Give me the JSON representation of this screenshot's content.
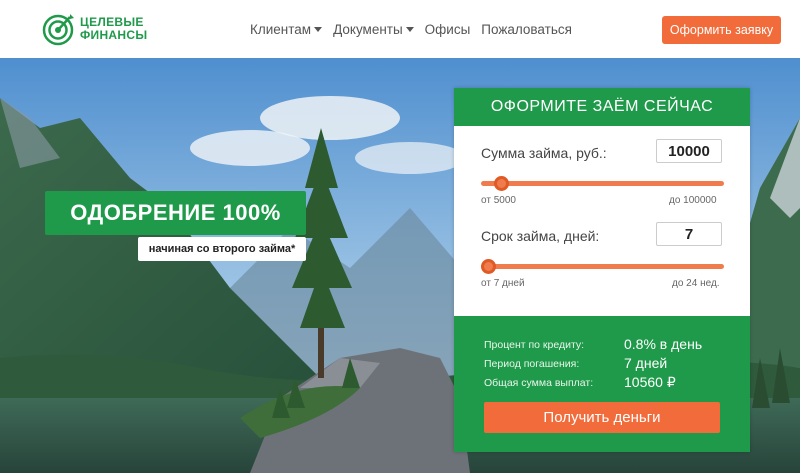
{
  "header": {
    "logo_line1": "ЦЕЛЕВЫЕ",
    "logo_line2": "ФИНАНСЫ",
    "nav": [
      {
        "label": "Клиентам",
        "dropdown": true
      },
      {
        "label": "Документы",
        "dropdown": true
      },
      {
        "label": "Офисы",
        "dropdown": false
      },
      {
        "label": "Пожаловаться",
        "dropdown": false
      }
    ],
    "cta_label": "Оформить заявку"
  },
  "hero": {
    "badge": "ОДОБРЕНИЕ 100%",
    "sub_badge": "начиная со второго займа*"
  },
  "form": {
    "title": "ОФОРМИТЕ ЗАЁМ СЕЙЧАС",
    "amount_label": "Сумма займа, руб.:",
    "amount_value": "10000",
    "amount_min": "от 5000",
    "amount_max": "до 100000",
    "term_label": "Срок займа, дней:",
    "term_value": "7",
    "term_min": "от 7 дней",
    "term_max": "до 24 нед.",
    "rate_label": "Процент по кредиту:",
    "rate_value": "0.8% в день",
    "period_label": "Период погашения:",
    "period_value": "7 дней",
    "total_label": "Общая сумма выплат:",
    "total_value": "10560 ₽",
    "submit_label": "Получить деньги"
  },
  "colors": {
    "brand_green": "#1f9a4a",
    "accent_orange": "#f26b3a"
  },
  "sliders": {
    "amount_fraction": 0.053,
    "term_fraction": 0.0
  }
}
